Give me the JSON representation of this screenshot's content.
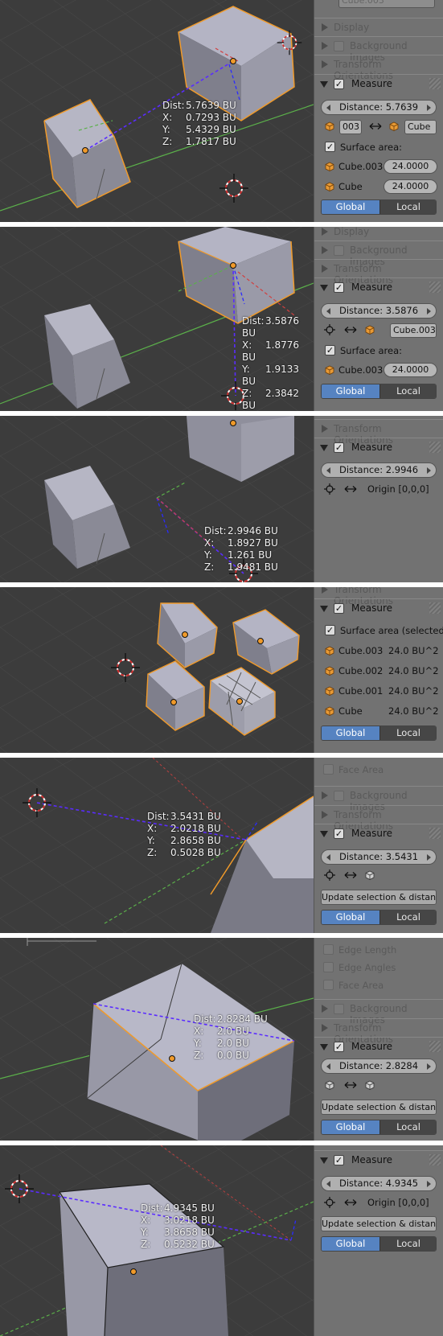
{
  "icons": {
    "cube": "cube-icon",
    "cursor": "3d-cursor-icon",
    "swap": "swap-arrows-icon",
    "mesh": "mesh-cube-icon"
  },
  "colors": {
    "global_active": "#5683c1",
    "selected_outline": "#f09a2a",
    "measure_line": "#5a2cff",
    "x_axis": "#b84040",
    "y_axis": "#5bb04a"
  },
  "shot1": {
    "panel": {
      "top_field": "Cube.003",
      "display": "Display",
      "background_images": "Background Images",
      "transform_orientations": "Transform Orientations",
      "measure": "Measure",
      "distance": "Distance: 5.7639",
      "obj_a": "003",
      "obj_b": "Cube",
      "surface_area": "Surface area:",
      "area_rows": [
        {
          "name": "Cube.003",
          "value": "24.0000"
        },
        {
          "name": "Cube",
          "value": "24.0000"
        }
      ],
      "global": "Global",
      "local": "Local"
    },
    "overlay": {
      "dist_k": "Dist:",
      "dist": "5.7639 BU",
      "x_k": "X:",
      "x": "0.7293 BU",
      "y_k": "Y:",
      "y": "5.4329 BU",
      "z_k": "Z:",
      "z": "1.7817 BU"
    }
  },
  "shot2": {
    "panel": {
      "display": "Display",
      "background_images": "Background Images",
      "transform_orientations": "Transform Orientations",
      "measure": "Measure",
      "distance": "Distance: 3.5876",
      "obj_b": "Cube.003",
      "surface_area": "Surface area:",
      "area_rows": [
        {
          "name": "Cube.003",
          "value": "24.0000"
        }
      ],
      "global": "Global",
      "local": "Local"
    },
    "overlay": {
      "dist_k": "Dist:",
      "dist": "3.5876 BU",
      "x_k": "X:",
      "x": "1.8776 BU",
      "y_k": "Y:",
      "y": "1.9133 BU",
      "z_k": "Z:",
      "z": "2.3842 BU"
    }
  },
  "shot3": {
    "panel": {
      "transform_orientations": "Transform Orientations",
      "measure": "Measure",
      "distance": "Distance: 2.9946",
      "origin": "Origin [0,0,0]"
    },
    "overlay": {
      "dist_k": "Dist:",
      "dist": "2.9946 BU",
      "x_k": "X:",
      "x": "1.8927 BU",
      "y_k": "Y:",
      "y": "1.261 BU",
      "z_k": "Z:",
      "z": "1.9481 BU"
    }
  },
  "shot4": {
    "panel": {
      "transform_orientations": "Transform Orientations",
      "measure": "Measure",
      "surface_area": "Surface area (selected fa",
      "area_rows": [
        {
          "name": "Cube.003",
          "value": "24.0 BU^2"
        },
        {
          "name": "Cube.002",
          "value": "24.0 BU^2"
        },
        {
          "name": "Cube.001",
          "value": "24.0 BU^2"
        },
        {
          "name": "Cube",
          "value": "24.0 BU^2"
        }
      ],
      "global": "Global",
      "local": "Local"
    }
  },
  "shot5": {
    "panel": {
      "face_area": "Face Area",
      "background_images": "Background Images",
      "transform_orientations": "Transform Orientations",
      "measure": "Measure",
      "distance": "Distance: 3.5431",
      "update": "Update selection & distance",
      "global": "Global",
      "local": "Local"
    },
    "overlay": {
      "dist_k": "Dist:",
      "dist": "3.5431 BU",
      "x_k": "X:",
      "x": "2.0218 BU",
      "y_k": "Y:",
      "y": "2.8658 BU",
      "z_k": "Z:",
      "z": "0.5028 BU"
    }
  },
  "shot6": {
    "panel": {
      "edge_length": "Edge Length",
      "edge_angles": "Edge Angles",
      "face_area": "Face Area",
      "background_images": "Background Images",
      "transform_orientations": "Transform Orientations",
      "measure": "Measure",
      "distance": "Distance: 2.8284",
      "update": "Update selection & distance",
      "global": "Global",
      "local": "Local"
    },
    "overlay": {
      "dist_k": "Dist:",
      "dist": "2.8284 BU",
      "x_k": "X:",
      "x": "2.0 BU",
      "y_k": "Y:",
      "y": "2.0 BU",
      "z_k": "Z:",
      "z": "0.0 BU"
    }
  },
  "shot7": {
    "panel": {
      "measure": "Measure",
      "distance": "Distance: 4.9345",
      "origin": "Origin [0,0,0]",
      "update": "Update selection & distance",
      "global": "Global",
      "local": "Local"
    },
    "overlay": {
      "dist_k": "Dist:",
      "dist": "4.9345 BU",
      "x_k": "X:",
      "x": "3.0218 BU",
      "y_k": "Y:",
      "y": "3.8658 BU",
      "z_k": "Z:",
      "z": "0.5232 BU"
    }
  }
}
